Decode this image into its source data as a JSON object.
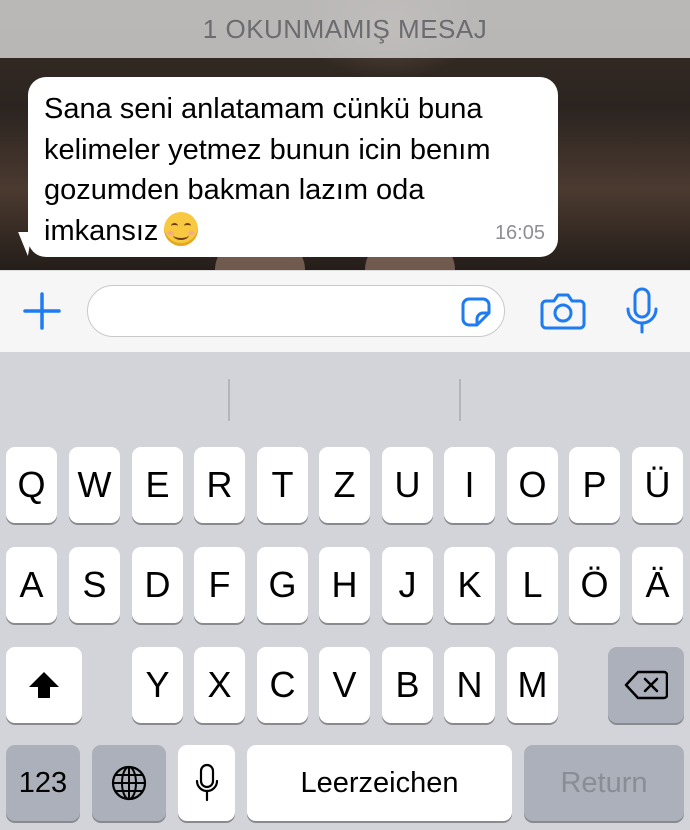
{
  "chat": {
    "unread_banner": "1 OKUNMAMIŞ MESAJ",
    "message": {
      "lines": [
        "Sana seni anlatamam cünkü buna",
        "kelimeler yetmez bunun icin benım",
        "gozumden bakman lazım oda",
        "imkansız"
      ],
      "emoji": "smiling-face-emoji",
      "time": "16:05"
    }
  },
  "input": {
    "value": "",
    "placeholder": "",
    "icons": [
      "plus-icon",
      "sticker-icon",
      "camera-icon",
      "microphone-icon"
    ],
    "accent_color": "#1e7bf2"
  },
  "keyboard": {
    "row1": [
      "Q",
      "W",
      "E",
      "R",
      "T",
      "Z",
      "U",
      "I",
      "O",
      "P",
      "Ü"
    ],
    "row2": [
      "A",
      "S",
      "D",
      "F",
      "G",
      "H",
      "J",
      "K",
      "L",
      "Ö",
      "Ä"
    ],
    "row3": [
      "Y",
      "X",
      "C",
      "V",
      "B",
      "N",
      "M"
    ],
    "numbers_label": "123",
    "space_label": "Leerzeichen",
    "return_label": "Return",
    "icons": [
      "shift-icon",
      "backspace-icon",
      "globe-icon",
      "dictation-mic-icon"
    ]
  }
}
